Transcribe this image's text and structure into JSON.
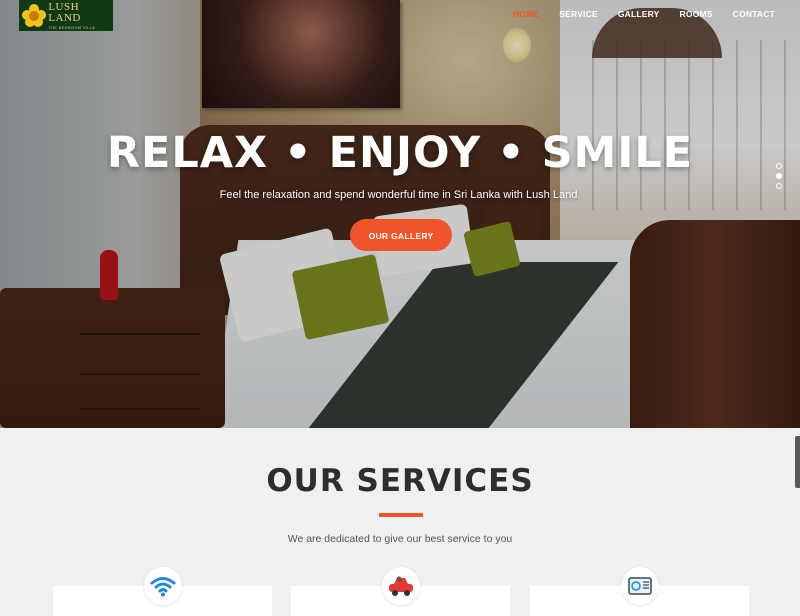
{
  "brand": {
    "name": "LUSH LAND",
    "tagline": "THE BEDROOM VILLA"
  },
  "nav": {
    "items": [
      {
        "label": "HOME",
        "active": true
      },
      {
        "label": "SERVICE",
        "active": false
      },
      {
        "label": "GALLERY",
        "active": false
      },
      {
        "label": "ROOMS",
        "active": false
      },
      {
        "label": "CONTACT",
        "active": false
      }
    ]
  },
  "hero": {
    "headline": "RELAX • ENJOY • SMILE",
    "subline": "Feel the relaxation and spend wonderful time in Sri Lanka with Lush Land.",
    "cta_label": "OUR GALLERY",
    "slides": 3,
    "active_slide": 1
  },
  "services": {
    "title": "OUR SERVICES",
    "subtitle": "We are dedicated to give our best service to you",
    "cards": [
      {
        "icon": "wifi-icon"
      },
      {
        "icon": "car-icon"
      },
      {
        "icon": "air-conditioner-icon"
      }
    ]
  },
  "colors": {
    "accent": "#f0552a",
    "logo_bg": "#123a12",
    "logo_flower": "#f3c21b",
    "wifi_blue": "#1e88e5",
    "car_red": "#e53935"
  }
}
